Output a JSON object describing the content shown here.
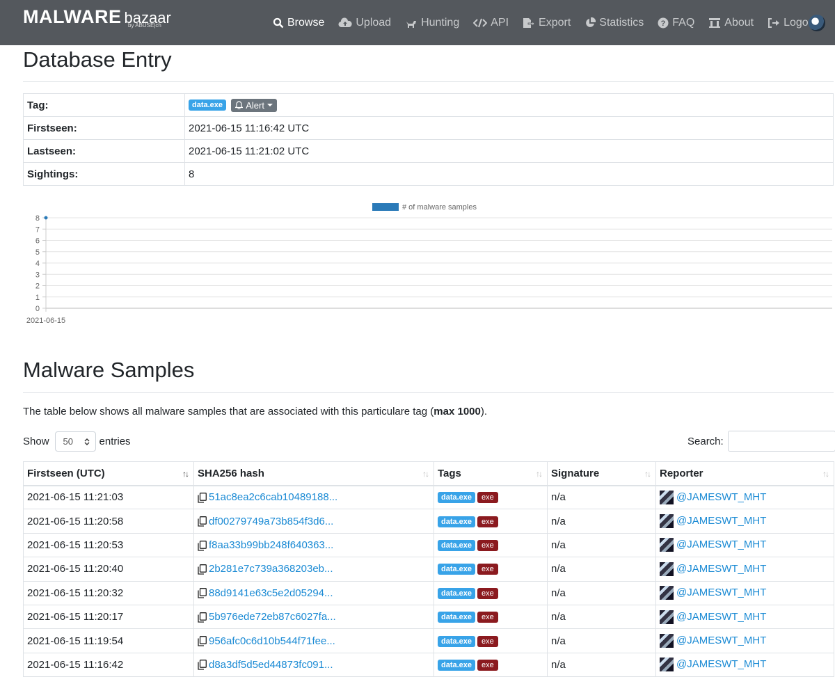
{
  "navbar": {
    "brand_main": "MALWARE",
    "brand_sub": "bazaar",
    "brand_by": "by ABUSE|ch",
    "items": [
      {
        "label": "Browse",
        "icon": "search-icon"
      },
      {
        "label": "Upload",
        "icon": "cloud-upload-icon"
      },
      {
        "label": "Hunting",
        "icon": "dog-icon"
      },
      {
        "label": "API",
        "icon": "code-icon"
      },
      {
        "label": "Export",
        "icon": "file-export-icon"
      },
      {
        "label": "Statistics",
        "icon": "pie-chart-icon"
      },
      {
        "label": "FAQ",
        "icon": "question-circle-icon"
      },
      {
        "label": "About",
        "icon": "landmark-icon"
      },
      {
        "label": "Logout",
        "icon": "sign-out-icon"
      }
    ]
  },
  "page_title": "Database Entry",
  "entry": {
    "tag_label": "Tag:",
    "tag_value": "data.exe",
    "alert_label": "Alert",
    "firstseen_label": "Firstseen:",
    "firstseen_value": "2021-06-15 11:16:42 UTC",
    "lastseen_label": "Lastseen:",
    "lastseen_value": "2021-06-15 11:21:02 UTC",
    "sightings_label": "Sightings:",
    "sightings_value": "8"
  },
  "chart_data": {
    "type": "line",
    "series": [
      {
        "name": "# of malware samples",
        "color": "#2a7ab8",
        "x": [
          "2021-06-15"
        ],
        "values": [
          8
        ]
      }
    ],
    "x": [
      "2021-06-15"
    ],
    "ylim": [
      0,
      8
    ],
    "yticks": [
      "0",
      "1",
      "2",
      "3",
      "4",
      "5",
      "6",
      "7",
      "8"
    ],
    "legend": "top-center",
    "grid": true
  },
  "samples_title": "Malware Samples",
  "intro_text": "The table below shows all malware samples that are associated with this particulare tag (",
  "intro_bold": "max 1000",
  "intro_end": ").",
  "show_label": "Show",
  "show_value": "50",
  "entries_label": "entries",
  "search_label": "Search:",
  "table": {
    "headers": [
      "Firstseen (UTC)",
      "SHA256 hash",
      "Tags",
      "Signature",
      "Reporter"
    ],
    "rows": [
      {
        "firstseen": "2021-06-15 11:21:03",
        "hash": "51ac8ea2c6cab10489188...",
        "tag": "data.exe",
        "tag2": "exe",
        "signature": "n/a",
        "reporter": "@JAMESWT_MHT"
      },
      {
        "firstseen": "2021-06-15 11:20:58",
        "hash": "df00279749a73b854f3d6...",
        "tag": "data.exe",
        "tag2": "exe",
        "signature": "n/a",
        "reporter": "@JAMESWT_MHT"
      },
      {
        "firstseen": "2021-06-15 11:20:53",
        "hash": "f8aa33b99bb248f640363...",
        "tag": "data.exe",
        "tag2": "exe",
        "signature": "n/a",
        "reporter": "@JAMESWT_MHT"
      },
      {
        "firstseen": "2021-06-15 11:20:40",
        "hash": "2b281e7c739a368203eb...",
        "tag": "data.exe",
        "tag2": "exe",
        "signature": "n/a",
        "reporter": "@JAMESWT_MHT"
      },
      {
        "firstseen": "2021-06-15 11:20:32",
        "hash": "88d9141e63c5e2d05294...",
        "tag": "data.exe",
        "tag2": "exe",
        "signature": "n/a",
        "reporter": "@JAMESWT_MHT"
      },
      {
        "firstseen": "2021-06-15 11:20:17",
        "hash": "5b976ede72eb87c6027fa...",
        "tag": "data.exe",
        "tag2": "exe",
        "signature": "n/a",
        "reporter": "@JAMESWT_MHT"
      },
      {
        "firstseen": "2021-06-15 11:19:54",
        "hash": "956afc0c6d10b544f71fee...",
        "tag": "data.exe",
        "tag2": "exe",
        "signature": "n/a",
        "reporter": "@JAMESWT_MHT"
      },
      {
        "firstseen": "2021-06-15 11:16:42",
        "hash": "d8a3df5d5ed44873fc091...",
        "tag": "data.exe",
        "tag2": "exe",
        "signature": "n/a",
        "reporter": "@JAMESWT_MHT"
      }
    ]
  }
}
